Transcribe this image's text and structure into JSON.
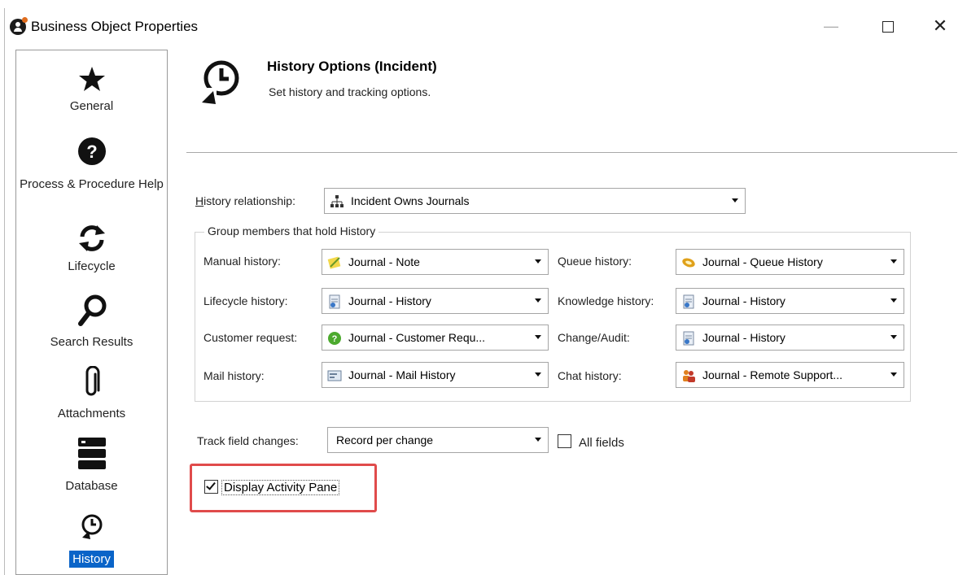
{
  "window": {
    "title": "Business Object Properties",
    "minimize": "—",
    "close": "✕"
  },
  "sidebar": {
    "items": [
      {
        "label": "General",
        "icon": "star-icon"
      },
      {
        "label": "Process & Procedure Help",
        "icon": "question-icon"
      },
      {
        "label": "Lifecycle",
        "icon": "refresh-icon"
      },
      {
        "label": "Search Results",
        "icon": "magnifier-icon"
      },
      {
        "label": "Attachments",
        "icon": "paperclip-icon"
      },
      {
        "label": "Database",
        "icon": "database-icon"
      },
      {
        "label": "History",
        "icon": "history-icon",
        "selected": true
      }
    ]
  },
  "header": {
    "title": "History Options  (Incident)",
    "subtitle": "Set history and tracking options."
  },
  "history_relationship": {
    "label": "History relationship:",
    "value": "Incident Owns Journals"
  },
  "group": {
    "title": "Group members that hold History",
    "fields": [
      {
        "label": "Manual history:",
        "value": "Journal - Note",
        "icon": "note-icon"
      },
      {
        "label": "Queue history:",
        "value": "Journal - Queue History",
        "icon": "queue-icon"
      },
      {
        "label": "Lifecycle history:",
        "value": "Journal - History",
        "icon": "journal-icon"
      },
      {
        "label": "Knowledge history:",
        "value": "Journal - History",
        "icon": "journal-icon"
      },
      {
        "label": "Customer request:",
        "value": "Journal  -  Customer  Requ...",
        "icon": "customer-request-icon"
      },
      {
        "label": "Change/Audit:",
        "value": "Journal - History",
        "icon": "journal-icon"
      },
      {
        "label": "Mail history:",
        "value": "Journal - Mail History",
        "icon": "mail-icon"
      },
      {
        "label": "Chat history:",
        "value": "Journal  -  Remote  Support...",
        "icon": "chat-people-icon"
      }
    ]
  },
  "track": {
    "label": "Track field changes:",
    "value": "Record per change",
    "all_fields_label": "All fields",
    "all_fields_checked": false
  },
  "display_activity": {
    "label": "Display Activity Pane",
    "checked": true
  },
  "colors": {
    "selection": "#0a64c8",
    "highlight_border": "#e04b4b"
  }
}
